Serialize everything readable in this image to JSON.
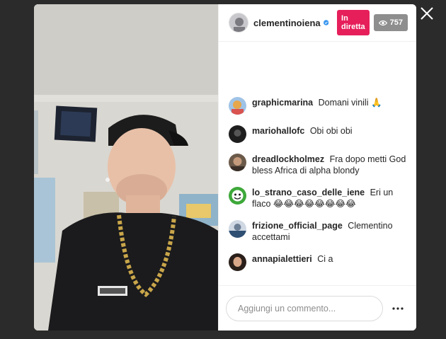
{
  "header": {
    "username": "clementinoiena",
    "live_label": "In diretta",
    "viewer_count": "757"
  },
  "comments": [
    {
      "user": "graphicmarina",
      "text": "Domani vinili 🙏"
    },
    {
      "user": "mariohallofc",
      "text": "Obi obi obi"
    },
    {
      "user": "dreadlockholmez",
      "text": "Fra dopo metti God bless Africa di alpha blondy"
    },
    {
      "user": "lo_strano_caso_delle_iene",
      "text": "Eri un flaco 😂😂😂😂😂😂😂😂"
    },
    {
      "user": "frizione_official_page",
      "text": "Clementino accettami"
    },
    {
      "user": "annapialettieri",
      "text": "Ci a"
    }
  ],
  "footer": {
    "comment_placeholder": "Aggiungi un commento..."
  },
  "colors": {
    "live": "#e61f5a",
    "viewers": "#8e8e8e",
    "verified": "#3897f0"
  },
  "icons": [
    "close-icon",
    "verified-icon",
    "eye-icon",
    "more-options-icon"
  ]
}
